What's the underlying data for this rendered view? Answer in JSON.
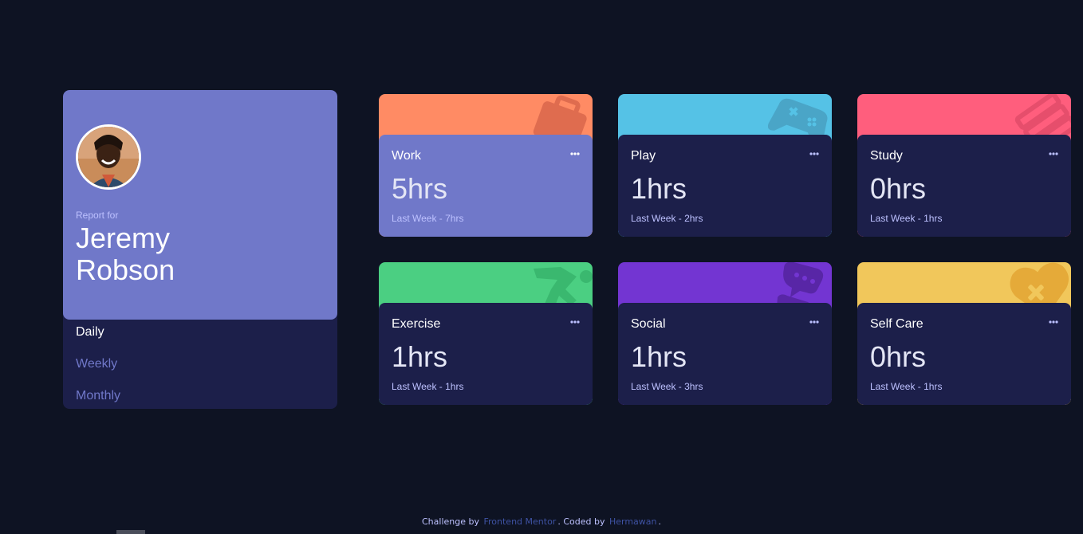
{
  "profile": {
    "report_label": "Report for",
    "name": "Jeremy Robson",
    "periods": [
      "Daily",
      "Weekly",
      "Monthly"
    ],
    "active_period": "Daily"
  },
  "cards": [
    {
      "title": "Work",
      "current": "5hrs",
      "previous": "Last Week - 7hrs",
      "color": "#ff8b64",
      "icon": "briefcase-icon"
    },
    {
      "title": "Play",
      "current": "1hrs",
      "previous": "Last Week - 2hrs",
      "color": "#55c2e6",
      "icon": "gamepad-icon"
    },
    {
      "title": "Study",
      "current": "0hrs",
      "previous": "Last Week - 1hrs",
      "color": "#ff5e7d",
      "icon": "books-icon"
    },
    {
      "title": "Exercise",
      "current": "1hrs",
      "previous": "Last Week - 1hrs",
      "color": "#4bcf82",
      "icon": "runner-icon"
    },
    {
      "title": "Social",
      "current": "1hrs",
      "previous": "Last Week - 3hrs",
      "color": "#7335d2",
      "icon": "chat-icon"
    },
    {
      "title": "Self Care",
      "current": "0hrs",
      "previous": "Last Week - 1hrs",
      "color": "#f1c75b",
      "icon": "heart-icon"
    }
  ],
  "footer": {
    "prefix": "Challenge by",
    "link1": "Frontend Mentor",
    "middle": ". Coded by",
    "link2": "Hermawan",
    "suffix": "."
  },
  "colors": {
    "background": "#0e1323",
    "card_body": "#1c1f4a",
    "accent": "#7078c9"
  }
}
